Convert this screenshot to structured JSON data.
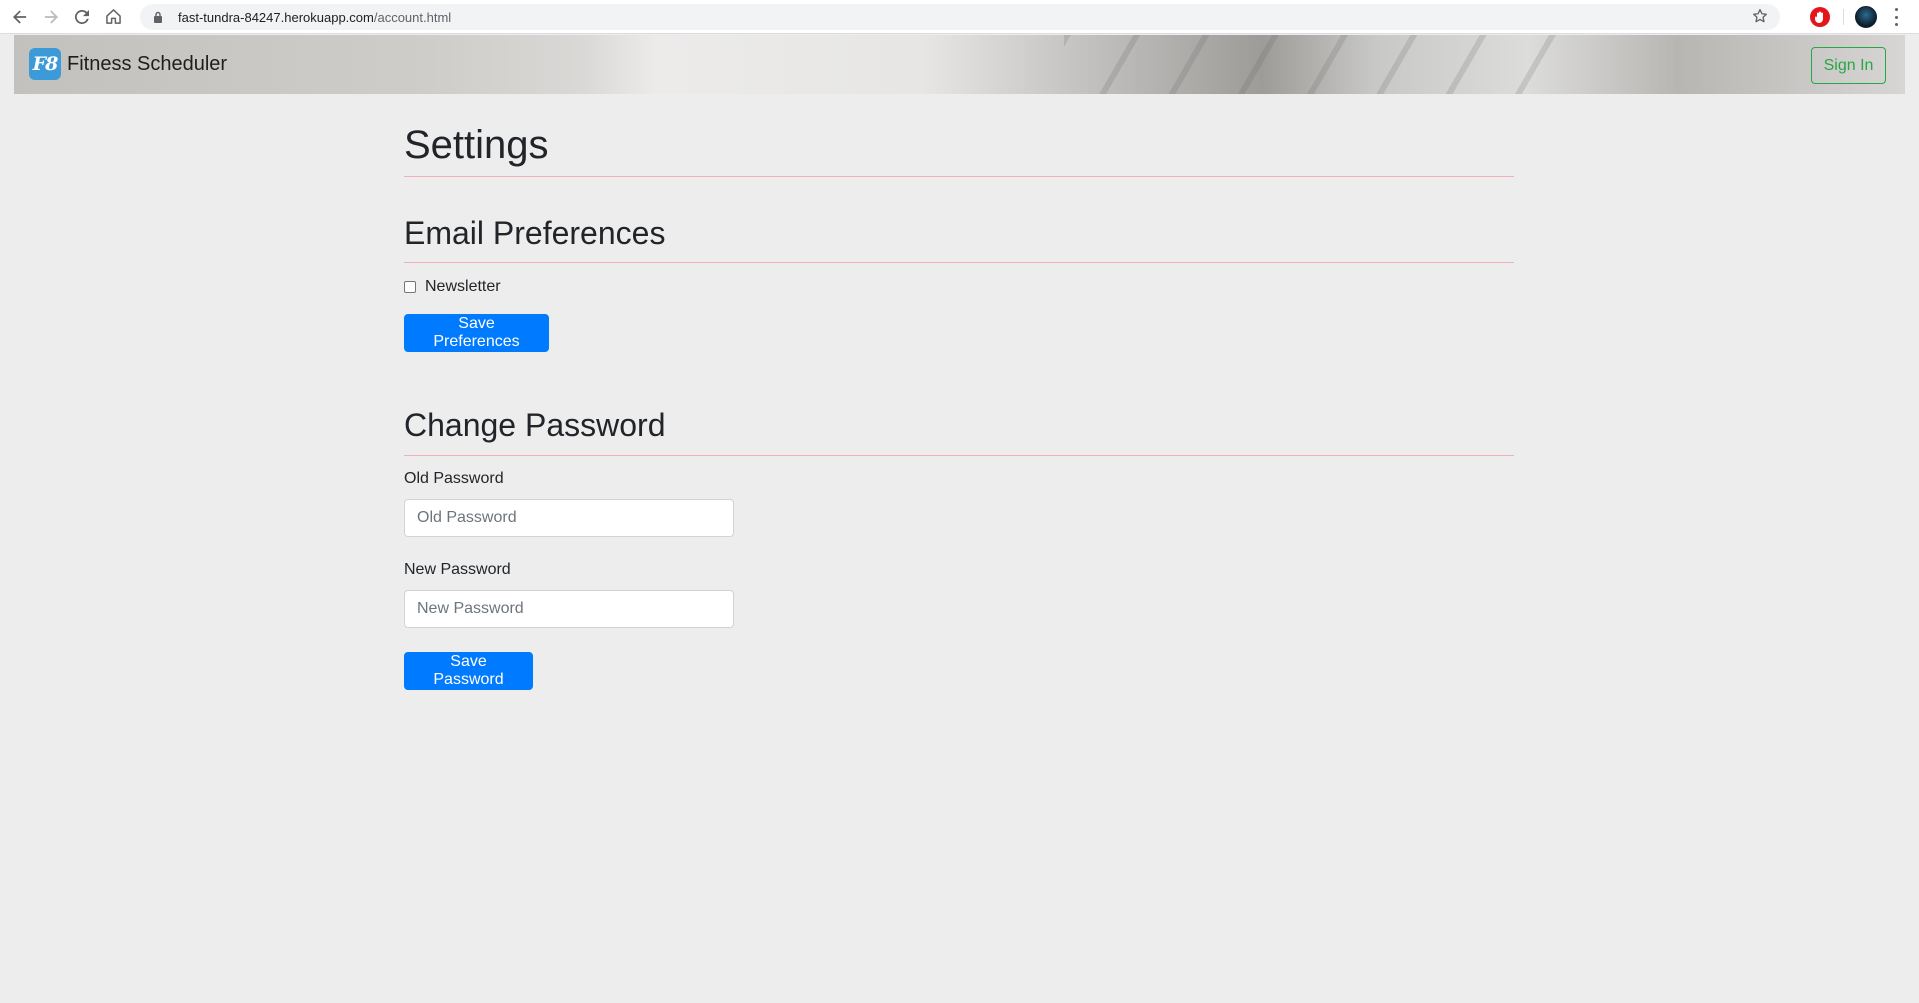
{
  "browser": {
    "url_host": "fast-tundra-84247.herokuapp.com",
    "url_path": "/account.html",
    "back_icon": "arrow-left-icon",
    "forward_icon": "arrow-right-icon",
    "reload_icon": "reload-icon",
    "home_icon": "home-icon",
    "bookmark_icon": "star-icon",
    "extension_icon": "stop-sign-icon",
    "menu_icon": "kebab-menu-icon"
  },
  "navbar": {
    "logo_text": "F8",
    "brand_name": "Fitness Scheduler",
    "signin_label": "Sign In"
  },
  "page": {
    "title": "Settings"
  },
  "email_preferences": {
    "heading": "Email Preferences",
    "newsletter_label": "Newsletter",
    "newsletter_checked": false,
    "save_label": "Save Preferences"
  },
  "change_password": {
    "heading": "Change Password",
    "old_label": "Old Password",
    "old_placeholder": "Old Password",
    "new_label": "New Password",
    "new_placeholder": "New Password",
    "save_label": "Save Password"
  },
  "colors": {
    "primary": "#007bff",
    "success": "#28a745",
    "rule": "#f1b0b7",
    "background": "#ededed"
  }
}
